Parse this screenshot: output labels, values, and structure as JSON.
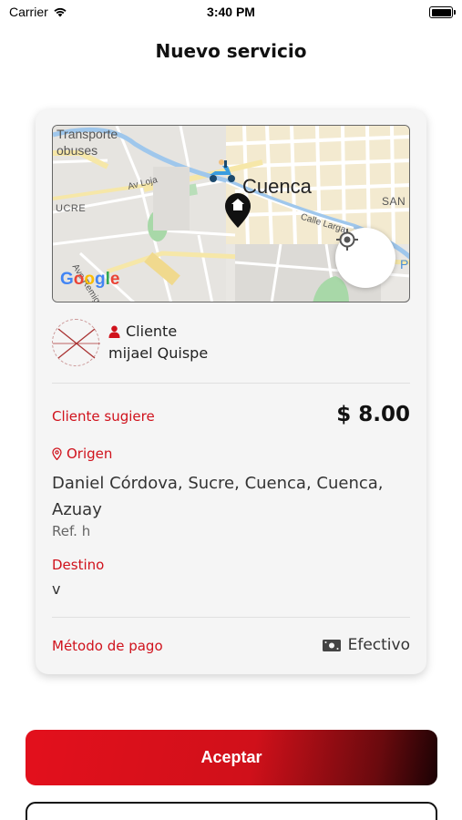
{
  "status_bar": {
    "carrier": "Carrier",
    "time": "3:40 PM"
  },
  "header": {
    "title": "Nuevo servicio"
  },
  "map": {
    "labels": {
      "transporte": "Transporte",
      "buses": "obuses",
      "city": "Cuenca",
      "av_loja": "Av Loja",
      "ucre": "UCRE",
      "san": "SAN",
      "calle_larga": "Calle Larga",
      "av_remigio": "Ave Remig... Cres",
      "p": "P",
      "google": [
        "G",
        "o",
        "o",
        "g",
        "l",
        "e"
      ]
    },
    "icons": [
      "scooter-icon",
      "home-pin-icon",
      "locate-icon"
    ]
  },
  "client": {
    "label": "Cliente",
    "name": "mijael Quispe"
  },
  "suggestion": {
    "label": "Cliente sugiere",
    "price": "$ 8.00"
  },
  "origin": {
    "label": "Origen",
    "address": "Daniel Córdova, Sucre, Cuenca, Cuenca, Azuay",
    "reference": "Ref. h"
  },
  "destination": {
    "label": "Destino",
    "value": "v"
  },
  "payment": {
    "label": "Método de pago",
    "method": "Efectivo"
  },
  "actions": {
    "accept": "Aceptar"
  },
  "colors": {
    "accent": "#d0121c",
    "dark": "#111111"
  }
}
